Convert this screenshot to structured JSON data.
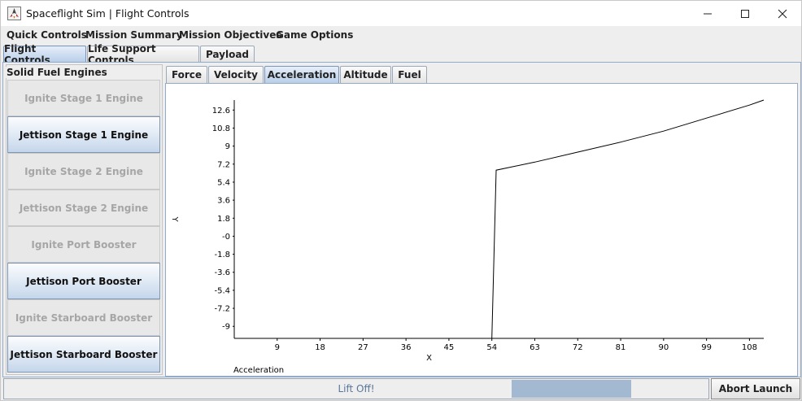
{
  "window": {
    "title": "Spaceflight Sim | Flight Controls"
  },
  "icons": {
    "app": "spaceship-icon",
    "minimize": "minimize-icon",
    "maximize": "maximize-icon",
    "close": "close-icon"
  },
  "menu": [
    "Quick Controls",
    "Mission Summary",
    "Mission Objectives",
    "Game Options"
  ],
  "top_tabs": {
    "items": [
      "Flight Controls",
      "Life Support Controls",
      "Payload"
    ],
    "selected": 0
  },
  "engines": {
    "group_title": "Solid Fuel Engines",
    "buttons": [
      {
        "label": "Ignite Stage 1 Engine",
        "enabled": false
      },
      {
        "label": "Jettison Stage 1 Engine",
        "enabled": true
      },
      {
        "label": "Ignite Stage 2 Engine",
        "enabled": false
      },
      {
        "label": "Jettison Stage 2 Engine",
        "enabled": false
      },
      {
        "label": "Ignite Port Booster",
        "enabled": false
      },
      {
        "label": "Jettison Port Booster",
        "enabled": true
      },
      {
        "label": "Ignite Starboard Booster",
        "enabled": false
      },
      {
        "label": "Jettison Starboard Booster",
        "enabled": true
      }
    ]
  },
  "chart_tabs": {
    "items": [
      "Force",
      "Velocity",
      "Acceleration",
      "Altitude",
      "Fuel"
    ],
    "selected": 2
  },
  "chart_data": {
    "type": "line",
    "title": "",
    "xlabel": "X",
    "ylabel": "Y",
    "legend": "Acceleration",
    "legend_position": "bottom-left",
    "xlim": [
      0,
      111
    ],
    "ylim": [
      -10.2,
      13.6
    ],
    "x_ticks": [
      9,
      18,
      27,
      36,
      45,
      54,
      63,
      72,
      81,
      90,
      99,
      108
    ],
    "y_ticks": [
      12.6,
      10.8,
      9,
      7.2,
      5.4,
      3.6,
      1.8,
      0,
      -1.8,
      -3.6,
      -5.4,
      -7.2,
      -9
    ],
    "y_tick_labels": [
      "12.6",
      "10.8",
      "9",
      "7.2",
      "5.4",
      "3.6",
      "1.8",
      "-0",
      "-1.8",
      "-3.6",
      "-5.4",
      "-7.2",
      "-9"
    ],
    "grid": false,
    "color": "#000000",
    "series": [
      {
        "name": "Acceleration",
        "x": [
          54,
          54.9,
          63,
          72,
          81,
          90,
          99,
          108,
          111
        ],
        "y": [
          -10.2,
          6.6,
          7.4,
          8.4,
          9.4,
          10.5,
          11.8,
          13.1,
          13.6
        ]
      }
    ]
  },
  "status": {
    "text": "Lift Off!",
    "progress_start": 0.72,
    "progress_end": 0.89
  },
  "abort": {
    "label": "Abort Launch"
  }
}
